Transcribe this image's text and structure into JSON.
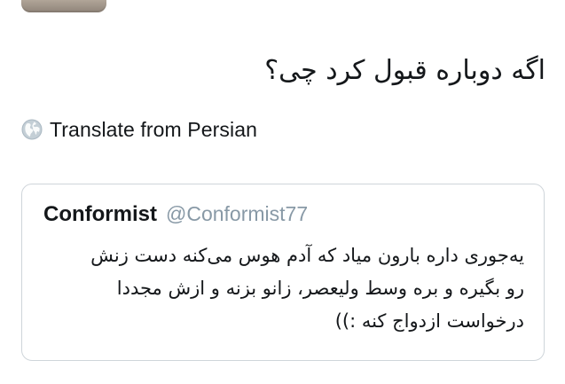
{
  "tweet": {
    "text": "اگه دوباره قبول کرد چی؟"
  },
  "translate": {
    "icon": "globe-icon",
    "label": "Translate from Persian"
  },
  "quoted_tweet": {
    "name": "Conformist",
    "handle": "@Conformist77",
    "lines": [
      "یه‌جوری داره بارون میاد که آدم هوس می‌کنه دست زنش",
      "رو بگیره و بره وسط ولیعصر، زانو بزنه و ازش مجددا",
      "درخواست ازدواج کنه :))"
    ]
  },
  "colors": {
    "text": "#14171a",
    "secondary": "#8899a6",
    "border": "#cfd5da",
    "globe": "#aab8c2"
  }
}
